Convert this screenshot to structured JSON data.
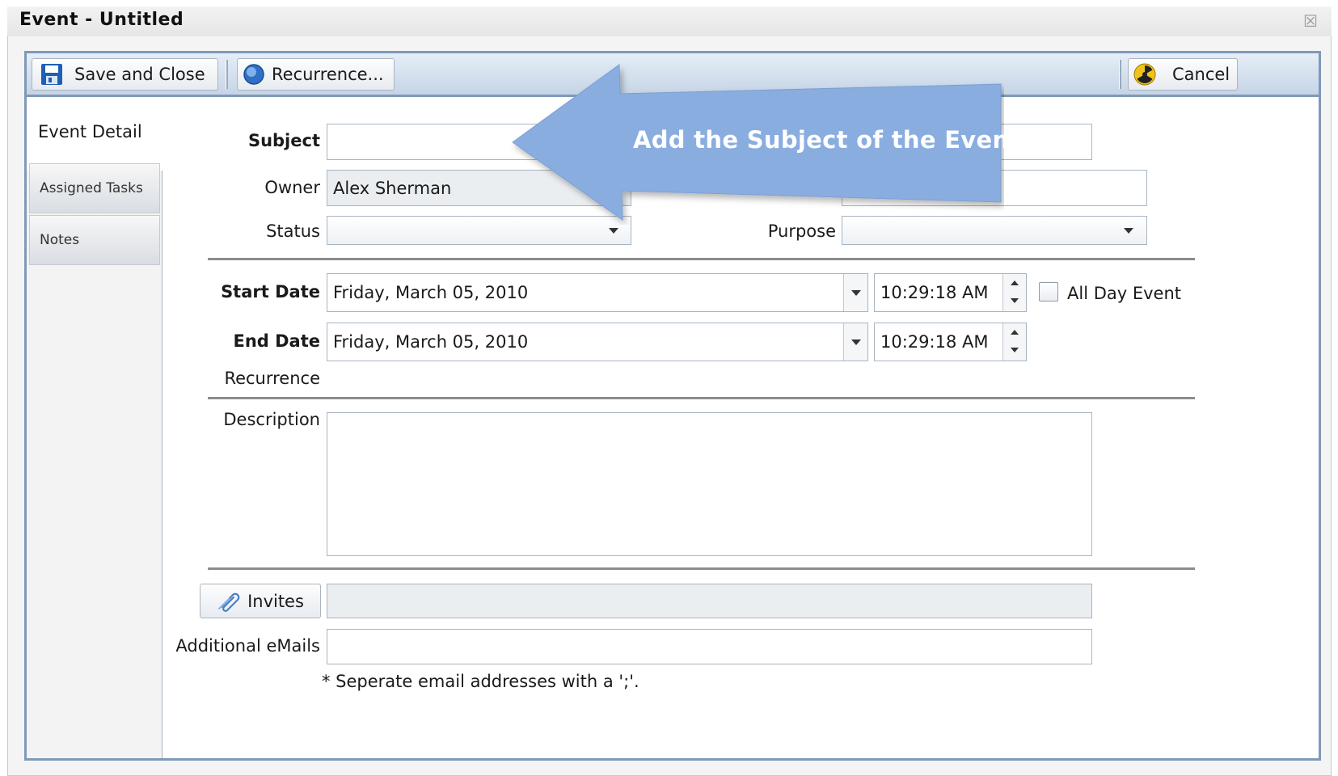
{
  "window": {
    "title": "Event - Untitled",
    "close_glyph": "☒"
  },
  "toolbar": {
    "save_close_label": "Save and Close",
    "recurrence_label": "Recurrence...",
    "cancel_label": "Cancel"
  },
  "tabs": {
    "event_detail": "Event Detail",
    "assigned_tasks": "Assigned Tasks",
    "notes": "Notes"
  },
  "form": {
    "subject_label": "Subject",
    "subject_value": "",
    "owner_label": "Owner",
    "owner_value": "Alex Sherman",
    "status_label": "Status",
    "status_value": "",
    "purpose_label": "Purpose",
    "purpose_value": "",
    "start_date_label": "Start Date",
    "start_date_value": "Friday, March 05, 2010",
    "start_time_value": "10:29:18 AM",
    "all_day_label": "All Day Event",
    "all_day_checked": false,
    "end_date_label": "End Date",
    "end_date_value": "Friday, March 05, 2010",
    "end_time_value": "10:29:18 AM",
    "recurrence_label": "Recurrence",
    "description_label": "Description",
    "invites_label": "Invites",
    "additional_emails_label": "Additional eMails",
    "email_note": "* Seperate email addresses with a ';'."
  },
  "callout": {
    "text": "Add the Subject of the Event.",
    "color": "#8aade0"
  },
  "colors": {
    "frame": "#7f99b8",
    "toolbar_top": "#e6eef7",
    "toolbar_bottom": "#c5d4e6"
  }
}
